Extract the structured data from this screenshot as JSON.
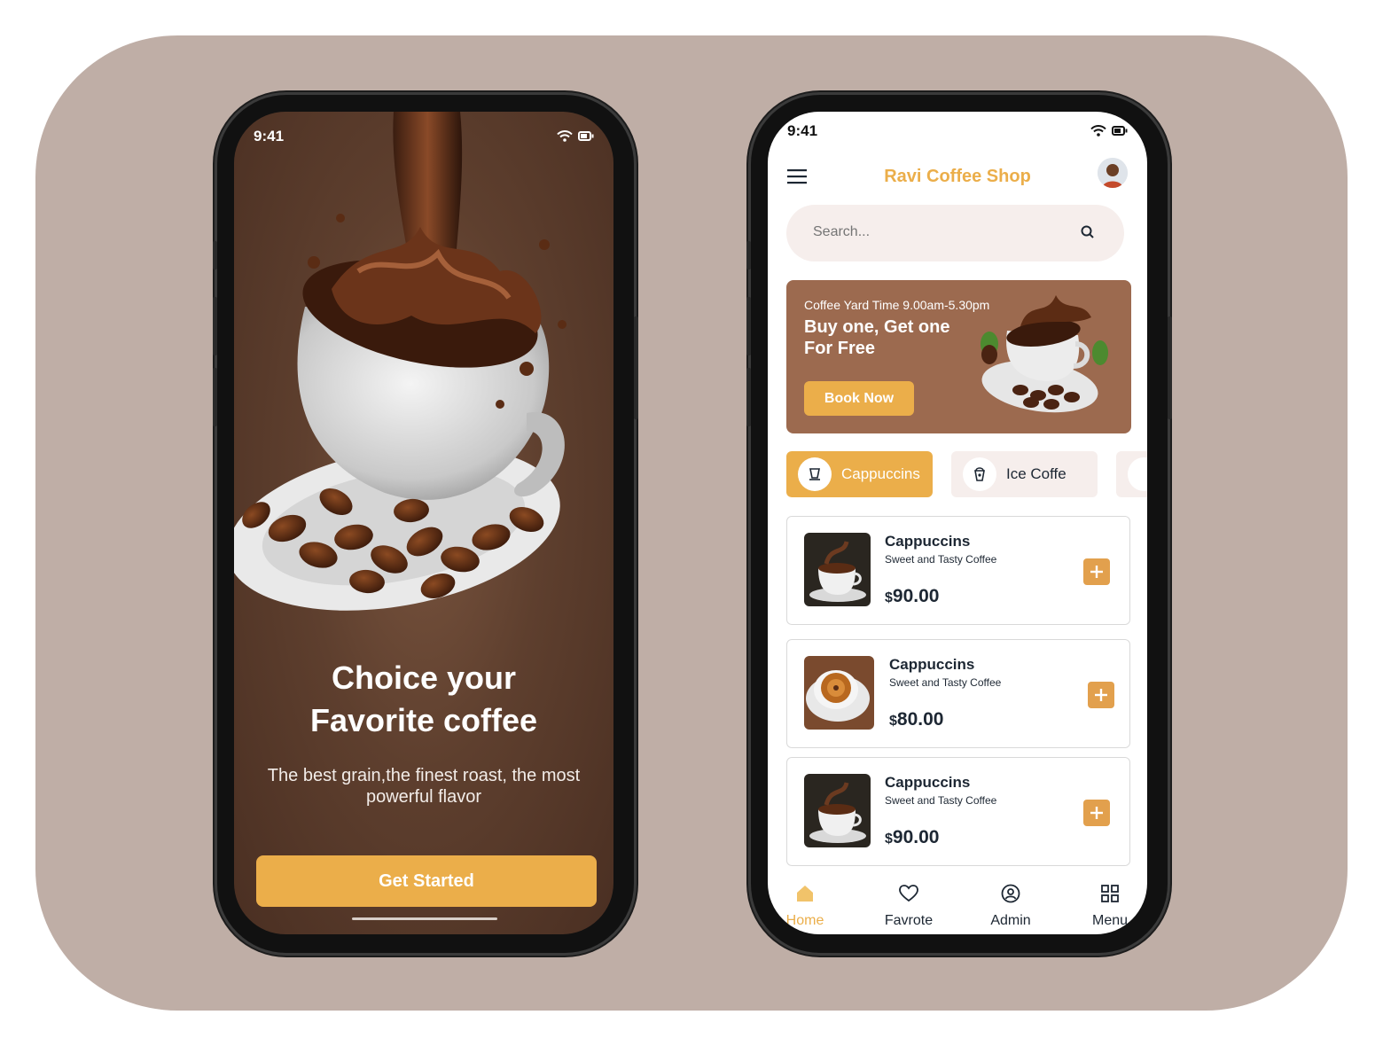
{
  "colors": {
    "accent": "#ebae4a",
    "background": "#bfaea6",
    "promo_bg": "#9c6a4f",
    "dark_text": "#1d2733"
  },
  "welcome_screen": {
    "status_time": "9:41",
    "title_line1": "Choice your",
    "title_line2": "Favorite coffee",
    "subtitle": "The best grain,the finest roast, the most powerful flavor",
    "cta_label": "Get Started"
  },
  "shop_screen": {
    "status_time": "9:41",
    "header": {
      "title": "Ravi Coffee Shop",
      "menu_icon": "hamburger-icon",
      "avatar_icon": "user-avatar"
    },
    "search": {
      "placeholder": "Search...",
      "icon": "search-icon"
    },
    "promo": {
      "time_text": "Coffee Yard Time 9.00am-5.30pm",
      "headline_line1": "Buy one, Get one",
      "headline_line2": "For Free",
      "button_label": "Book Now"
    },
    "categories": [
      {
        "label": "Cappuccins",
        "icon": "coffee-cup-icon",
        "active": true
      },
      {
        "label": "Ice Coffe",
        "icon": "iced-coffee-icon",
        "active": false
      }
    ],
    "products": [
      {
        "name": "Cappuccins",
        "description": "Sweet and Tasty Coffee",
        "currency": "$",
        "price": "90.00"
      },
      {
        "name": "Cappuccins",
        "description": "Sweet and Tasty Coffee",
        "currency": "$",
        "price": "80.00"
      },
      {
        "name": "Cappuccins",
        "description": "Sweet and Tasty Coffee",
        "currency": "$",
        "price": "90.00"
      }
    ],
    "tabs": [
      {
        "label": "Home",
        "icon": "home-icon",
        "active": true
      },
      {
        "label": "Favrote",
        "icon": "heart-icon",
        "active": false
      },
      {
        "label": "Admin",
        "icon": "user-circle-icon",
        "active": false
      },
      {
        "label": "Menu",
        "icon": "grid-icon",
        "active": false
      }
    ]
  }
}
